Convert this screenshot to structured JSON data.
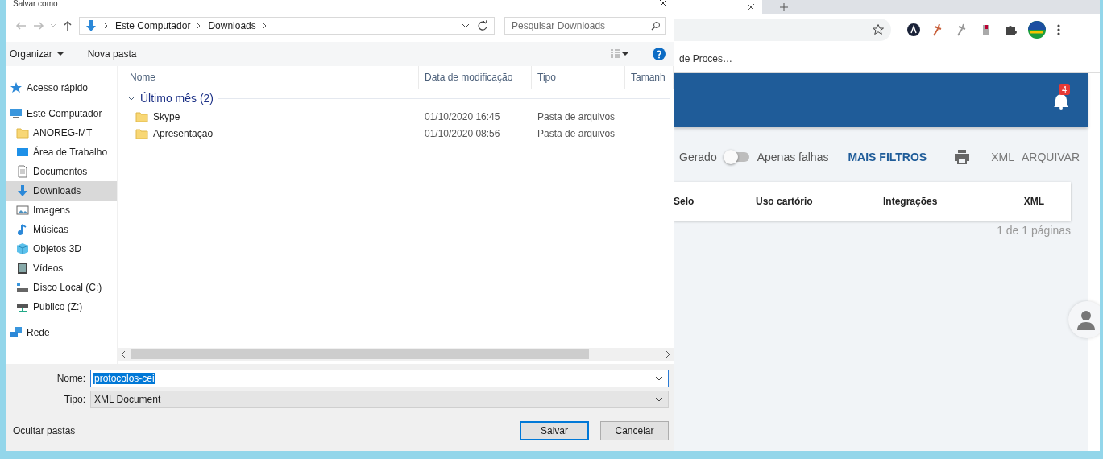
{
  "dialog": {
    "title": "Salvar como",
    "breadcrumb": [
      "Este Computador",
      "Downloads"
    ],
    "search": {
      "placeholder": "Pesquisar Downloads"
    },
    "toolbar": {
      "organize": "Organizar",
      "new_folder": "Nova pasta"
    },
    "sidebar": {
      "items": [
        {
          "label": "Acesso rápido",
          "kind": "star",
          "selected": false
        },
        {
          "label": "Este Computador",
          "kind": "computer",
          "selected": false,
          "children": [
            {
              "label": "ANOREG-MT",
              "kind": "folder",
              "selected": false
            },
            {
              "label": "Área de Trabalho",
              "kind": "desktop",
              "selected": false
            },
            {
              "label": "Documentos",
              "kind": "document",
              "selected": false
            },
            {
              "label": "Downloads",
              "kind": "download",
              "selected": true
            },
            {
              "label": "Imagens",
              "kind": "image",
              "selected": false
            },
            {
              "label": "Músicas",
              "kind": "music",
              "selected": false
            },
            {
              "label": "Objetos 3D",
              "kind": "cube",
              "selected": false
            },
            {
              "label": "Vídeos",
              "kind": "film",
              "selected": false
            },
            {
              "label": "Disco Local (C:)",
              "kind": "drive",
              "selected": false
            },
            {
              "label": "Publico (Z:)",
              "kind": "netdrive",
              "selected": false
            }
          ]
        },
        {
          "label": "Rede",
          "kind": "network",
          "selected": false
        }
      ]
    },
    "columns": [
      "Nome",
      "Data de modificação",
      "Tipo",
      "Tamanh"
    ],
    "group": {
      "label": "Último mês (2)",
      "expanded": true
    },
    "files": [
      {
        "name": "Skype",
        "modified": "01/10/2020 16:45",
        "type": "Pasta de arquivos"
      },
      {
        "name": "Apresentação",
        "modified": "01/10/2020 08:56",
        "type": "Pasta de arquivos"
      }
    ],
    "filename": {
      "label": "Nome:",
      "value": "protocolos-cei"
    },
    "filetype": {
      "label": "Tipo:",
      "value": "XML Document"
    },
    "hide_folders": "Ocultar pastas",
    "buttons": [
      {
        "label": "Salvar",
        "kind": "primary"
      },
      {
        "label": "Cancelar",
        "kind": "secondary"
      }
    ]
  },
  "browser": {
    "bookmark": "de Proces…",
    "notifications": "4",
    "filters": {
      "left_label": "Gerado",
      "toggle": {
        "label": "Apenas falhas",
        "on": false
      },
      "more": "MAIS FILTROS",
      "actions": [
        "XML",
        "ARQUIVAR"
      ]
    },
    "table": {
      "columns": [
        "Selo",
        "Uso cartório",
        "Integrações",
        "XML"
      ]
    },
    "pagination": "1 de 1 páginas"
  }
}
